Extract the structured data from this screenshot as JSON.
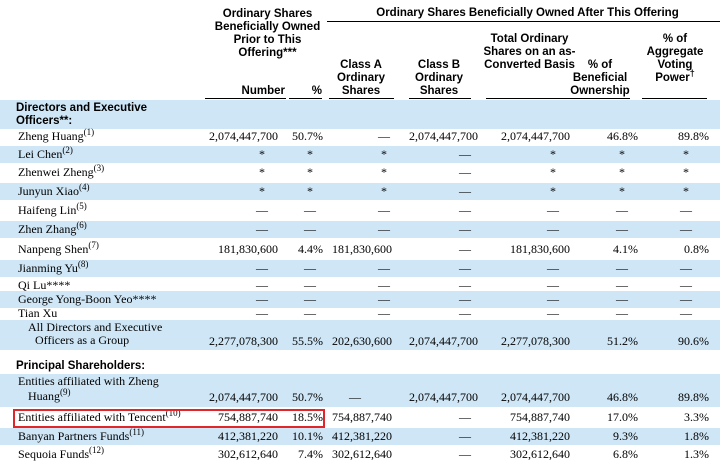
{
  "header": {
    "prior_group": "Ordinary Shares Beneficially Owned Prior to This Offering***",
    "after_group": "Ordinary Shares Beneficially Owned After This Offering",
    "col_number": "Number",
    "col_pct": "%",
    "col_class_a": "Class A Ordinary Shares",
    "col_class_b": "Class B Ordinary Shares",
    "col_total": "Total Ordinary Shares on an as-Converted Basis",
    "col_beneficial": "% of Beneficial Ownership",
    "col_voting": "% of Aggregate Voting Power",
    "col_voting_mark": "†"
  },
  "sections": {
    "directors": "Directors and Executive Officers**:",
    "principal": "Principal Shareholders:"
  },
  "rows": [
    {
      "name": "Zheng Huang",
      "note": "(1)",
      "number": "2,074,447,700",
      "pct": "50.7%",
      "class_a": "—",
      "class_b": "2,074,447,700",
      "total": "2,074,447,700",
      "beneficial": "46.8%",
      "voting": "89.8%"
    },
    {
      "name": "Lei Chen",
      "note": "(2)",
      "number": "*",
      "pct": "*",
      "class_a": "*",
      "class_b": "—",
      "total": "*",
      "beneficial": "*",
      "voting": "*"
    },
    {
      "name": "Zhenwei Zheng",
      "note": "(3)",
      "number": "*",
      "pct": "*",
      "class_a": "*",
      "class_b": "—",
      "total": "*",
      "beneficial": "*",
      "voting": "*"
    },
    {
      "name": "Junyun Xiao",
      "note": "(4)",
      "number": "*",
      "pct": "*",
      "class_a": "*",
      "class_b": "—",
      "total": "*",
      "beneficial": "*",
      "voting": "*"
    },
    {
      "name": "Haifeng Lin",
      "note": "(5)",
      "number": "—",
      "pct": "—",
      "class_a": "—",
      "class_b": "—",
      "total": "—",
      "beneficial": "—",
      "voting": "—"
    },
    {
      "name": "Zhen Zhang",
      "note": "(6)",
      "number": "—",
      "pct": "—",
      "class_a": "—",
      "class_b": "—",
      "total": "—",
      "beneficial": "—",
      "voting": "—"
    },
    {
      "name": "Nanpeng Shen",
      "note": "(7)",
      "number": "181,830,600",
      "pct": "4.4%",
      "class_a": "181,830,600",
      "class_b": "—",
      "total": "181,830,600",
      "beneficial": "4.1%",
      "voting": "0.8%"
    },
    {
      "name": "Jianming Yu",
      "note": "(8)",
      "number": "—",
      "pct": "—",
      "class_a": "—",
      "class_b": "—",
      "total": "—",
      "beneficial": "—",
      "voting": "—"
    },
    {
      "name": "Qi Lu****",
      "note": "",
      "number": "—",
      "pct": "—",
      "class_a": "—",
      "class_b": "—",
      "total": "—",
      "beneficial": "—",
      "voting": "—"
    },
    {
      "name": "George Yong-Boon Yeo****",
      "note": "",
      "number": "—",
      "pct": "—",
      "class_a": "—",
      "class_b": "—",
      "total": "—",
      "beneficial": "—",
      "voting": "—"
    },
    {
      "name": "Tian Xu",
      "note": "",
      "number": "—",
      "pct": "—",
      "class_a": "—",
      "class_b": "—",
      "total": "—",
      "beneficial": "—",
      "voting": "—"
    }
  ],
  "group_row": {
    "line1": "All Directors and Executive",
    "line2": "Officers as a Group",
    "number": "2,277,078,300",
    "pct": "55.5%",
    "class_a": "202,630,600",
    "class_b": "2,074,447,700",
    "total": "2,277,078,300",
    "beneficial": "51.2%",
    "voting": "90.6%"
  },
  "zheng_entities": {
    "line1": "Entities affiliated with Zheng",
    "line2": "Huang",
    "note": "(9)",
    "number": "2,074,447,700",
    "pct": "50.7%",
    "class_a": "—",
    "class_b": "2,074,447,700",
    "total": "2,074,447,700",
    "beneficial": "46.8%",
    "voting": "89.8%"
  },
  "principal_rows": [
    {
      "name": "Entities affiliated with Tencent",
      "note": "(10)",
      "number": "754,887,740",
      "pct": "18.5%",
      "class_a": "754,887,740",
      "class_b": "—",
      "total": "754,887,740",
      "beneficial": "17.0%",
      "voting": "3.3%"
    },
    {
      "name": "Banyan Partners Funds",
      "note": "(11)",
      "number": "412,381,220",
      "pct": "10.1%",
      "class_a": "412,381,220",
      "class_b": "—",
      "total": "412,381,220",
      "beneficial": "9.3%",
      "voting": "1.8%"
    },
    {
      "name": "Sequoia Funds",
      "note": "(12)",
      "number": "302,612,640",
      "pct": "7.4%",
      "class_a": "302,612,640",
      "class_b": "—",
      "total": "302,612,640",
      "beneficial": "6.8%",
      "voting": "1.3%"
    }
  ],
  "colors": {
    "row_shade": "#cfe6f6",
    "highlight_border": "#e0262b"
  }
}
